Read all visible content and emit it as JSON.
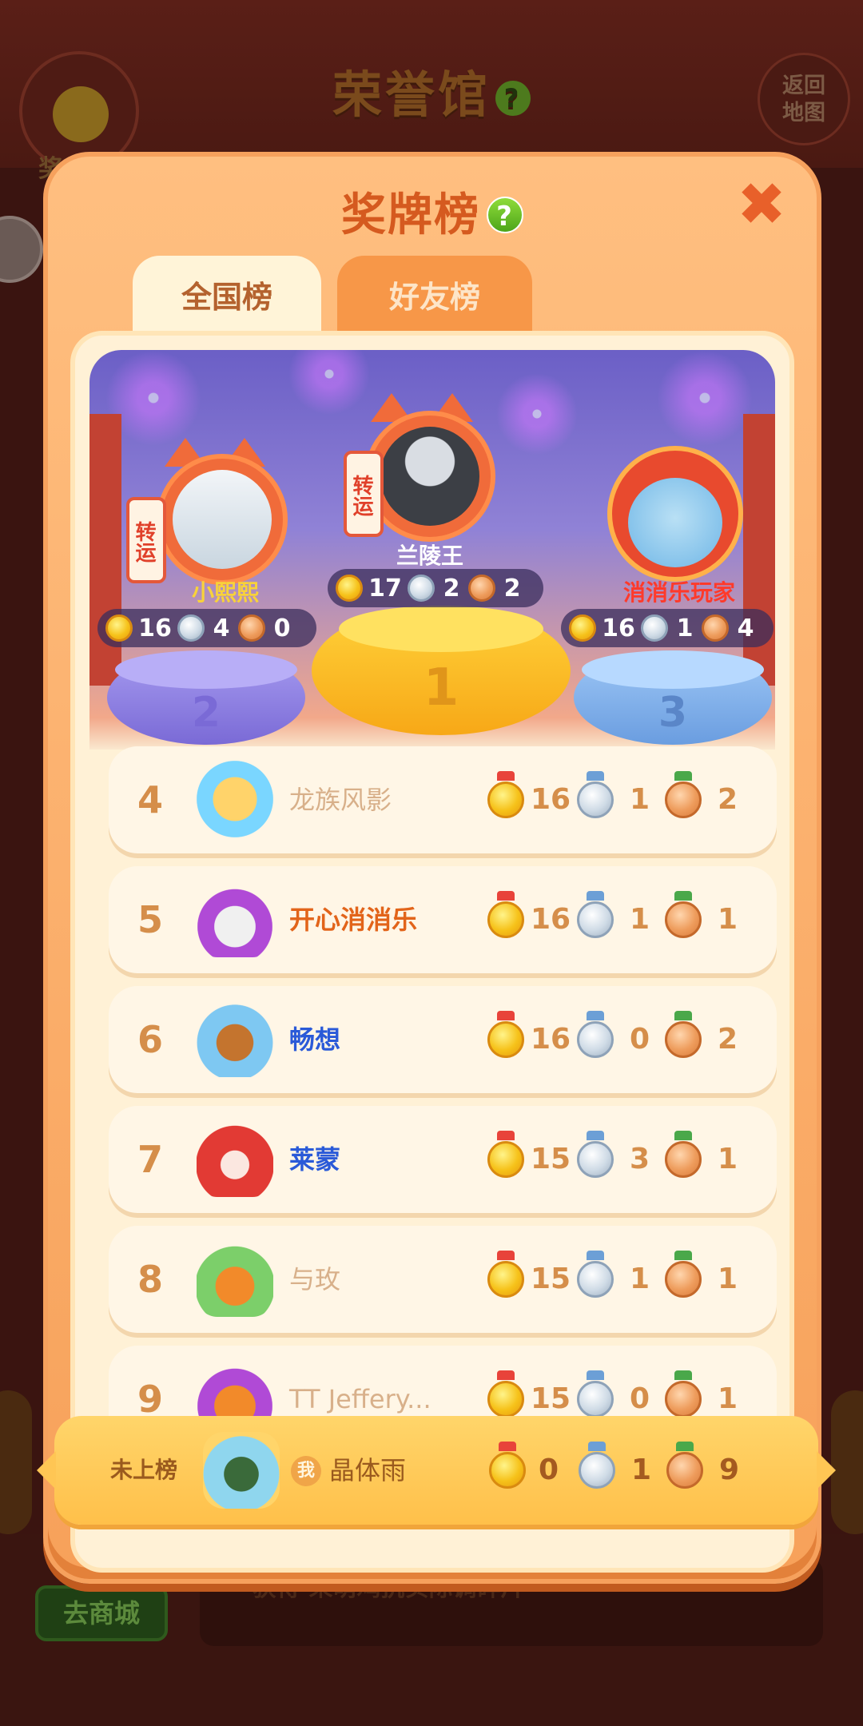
{
  "background": {
    "title": "荣誉馆",
    "medal_button_label": "奖",
    "return_button_label": "返回\n地图",
    "shop_button_label": "去商城",
    "bottom_text": "获得 荣萌鸡抗实际调碎片"
  },
  "modal": {
    "title": "奖牌榜",
    "tabs": [
      {
        "label": "全国榜",
        "active": true
      },
      {
        "label": "好友榜",
        "active": false
      }
    ],
    "lucky_tag": "转运"
  },
  "podium": [
    {
      "rank": "2",
      "name": "小熙熙",
      "name_color": "#f8d23a",
      "gold": "16",
      "silver": "4",
      "bronze": "0"
    },
    {
      "rank": "1",
      "name": "兰陵王",
      "name_color": "#ffffff",
      "gold": "17",
      "silver": "2",
      "bronze": "2"
    },
    {
      "rank": "3",
      "name": "消消乐玩家",
      "name_color": "#ff3a2a",
      "gold": "16",
      "silver": "1",
      "bronze": "4"
    }
  ],
  "rows": [
    {
      "rank": "4",
      "name": "龙族风影",
      "name_color": "#d8b08a",
      "gold": "16",
      "silver": "1",
      "bronze": "2"
    },
    {
      "rank": "5",
      "name": "开心消消乐",
      "name_color": "#e2641a",
      "gold": "16",
      "silver": "1",
      "bronze": "1"
    },
    {
      "rank": "6",
      "name": "畅想",
      "name_color": "#2a5ad8",
      "gold": "16",
      "silver": "0",
      "bronze": "2"
    },
    {
      "rank": "7",
      "name": "莱蒙",
      "name_color": "#2a5ad8",
      "gold": "15",
      "silver": "3",
      "bronze": "1"
    },
    {
      "rank": "8",
      "name": "与玫",
      "name_color": "#d8b08a",
      "gold": "15",
      "silver": "1",
      "bronze": "1"
    },
    {
      "rank": "9",
      "name": "TT Jeffery...",
      "name_color": "#d8b08a",
      "gold": "15",
      "silver": "0",
      "bronze": "1"
    }
  ],
  "self": {
    "rank_label": "未上榜",
    "me_badge": "我",
    "name": "晶体雨",
    "gold": "0",
    "silver": "1",
    "bronze": "9"
  },
  "colors": {
    "accent": "#d55a1f",
    "panel": "#fff1d6",
    "gold": "#f6c21a",
    "silver": "#cfdbe6",
    "bronze": "#ee9c5c"
  }
}
